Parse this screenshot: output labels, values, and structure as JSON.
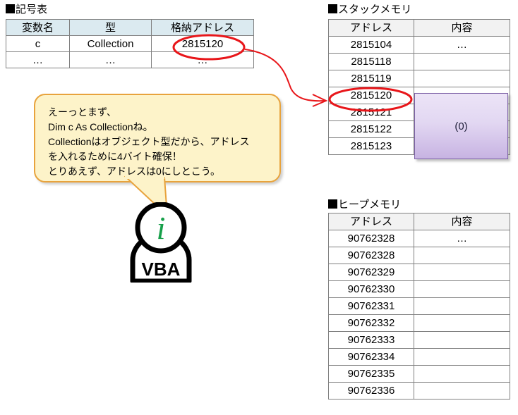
{
  "symbol_table": {
    "title": "■記号表",
    "columns": [
      "変数名",
      "型",
      "格納アドレス"
    ],
    "rows": [
      [
        "c",
        "Collection",
        "2815120"
      ],
      [
        "…",
        "…",
        "…"
      ]
    ],
    "header_bg": "#dbeaf0",
    "highlight_cell": "2815120"
  },
  "stack_memory": {
    "title": "■スタックメモリ",
    "columns": [
      "アドレス",
      "内容"
    ],
    "rows": [
      [
        "2815104",
        "…"
      ],
      [
        "2815118",
        ""
      ],
      [
        "2815119",
        ""
      ],
      [
        "2815120",
        ""
      ],
      [
        "2815121",
        ""
      ],
      [
        "2815122",
        ""
      ],
      [
        "2815123",
        ""
      ]
    ],
    "header_bg": "#f2f2f2",
    "highlight_cell": "2815120",
    "allocated_block": {
      "label": "(0)",
      "spans_rows": 4,
      "fill_top": "#ece4f7",
      "fill_bottom": "#c7b3e2",
      "border": "#7f63a8"
    }
  },
  "heap_memory": {
    "title": "■ヒープメモリ",
    "columns": [
      "アドレス",
      "内容"
    ],
    "rows": [
      [
        "90762328",
        "…"
      ],
      [
        "90762328",
        ""
      ],
      [
        "90762329",
        ""
      ],
      [
        "90762330",
        ""
      ],
      [
        "90762331",
        ""
      ],
      [
        "90762332",
        ""
      ],
      [
        "90762333",
        ""
      ],
      [
        "90762334",
        ""
      ],
      [
        "90762335",
        ""
      ],
      [
        "90762336",
        ""
      ]
    ],
    "header_bg": "#f2f2f2"
  },
  "speech_bubble": {
    "text": "えーっとまず、\nDim c As Collectionね。\nCollectionはオブジェクト型だから、アドレス\nを入れるために4バイト確保！\nとりあえず、アドレスは0にしとこう。",
    "fill": "#fdf3c9",
    "border": "#e8a33d"
  },
  "mascot": {
    "letter": "i",
    "label": "VBA",
    "letter_color": "#17a04a",
    "outline_color": "#000000"
  },
  "annotations": {
    "accent_color": "#e8161a",
    "connector_description": "arrow-from-symbol-table-address-to-stack-address"
  }
}
